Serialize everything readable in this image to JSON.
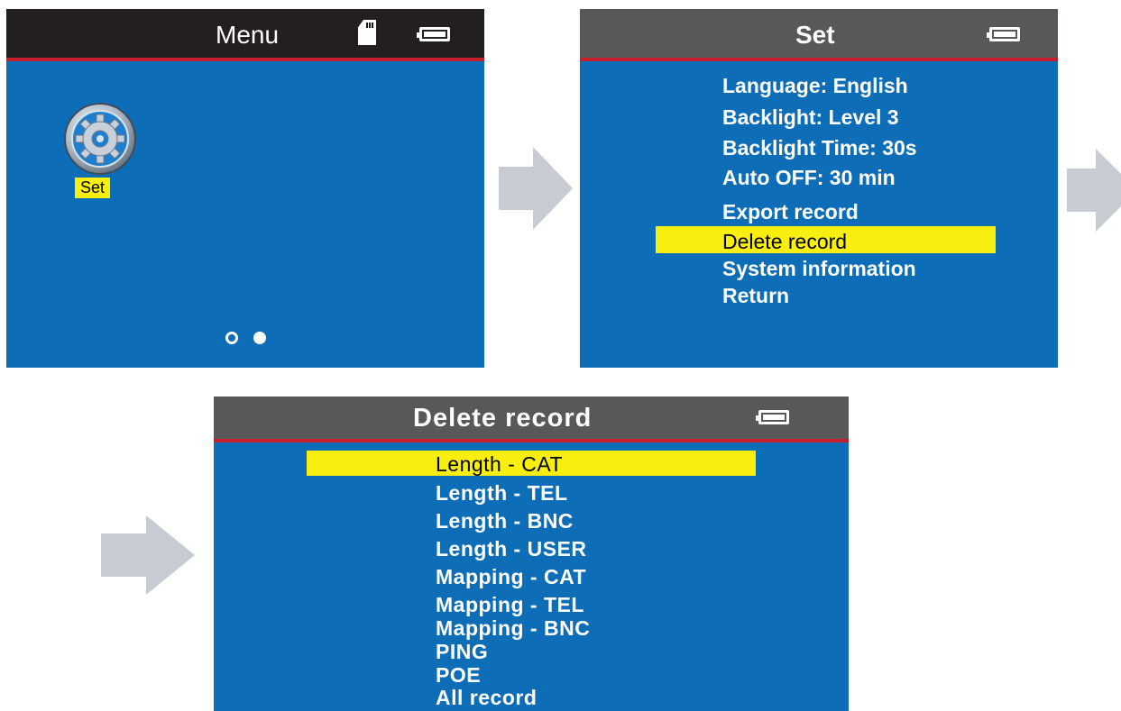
{
  "screens": {
    "menu": {
      "title": "Menu",
      "icons": {
        "sd_card": "sdcard-icon",
        "battery": "battery-icon",
        "settings": "gear-icon"
      },
      "set_label": "Set",
      "page_indicator": {
        "pages": 2,
        "current": 2
      }
    },
    "set": {
      "title": "Set",
      "icons": {
        "battery": "battery-icon"
      },
      "items": [
        "Language: English",
        "Backlight: Level 3",
        "Backlight Time: 30s",
        "Auto OFF: 30 min",
        "Export record",
        "Delete record",
        "System information",
        "Return"
      ],
      "selected_index": 5
    },
    "delete_record": {
      "title": "Delete record",
      "icons": {
        "battery": "battery-icon"
      },
      "items": [
        "Length - CAT",
        "Length - TEL",
        "Length - BNC",
        "Length - USER",
        "Mapping - CAT",
        "Mapping - TEL",
        "Mapping - BNC",
        "PING",
        "POE",
        "All record"
      ],
      "selected_index": 0
    }
  },
  "colors": {
    "screen_bg": "#0d6db7",
    "menu_title_bar": "#231f20",
    "title_bar": "#595758",
    "title_accent": "#c7202c",
    "highlight": "#f8ee10",
    "arrow": "#c7ccd3"
  }
}
